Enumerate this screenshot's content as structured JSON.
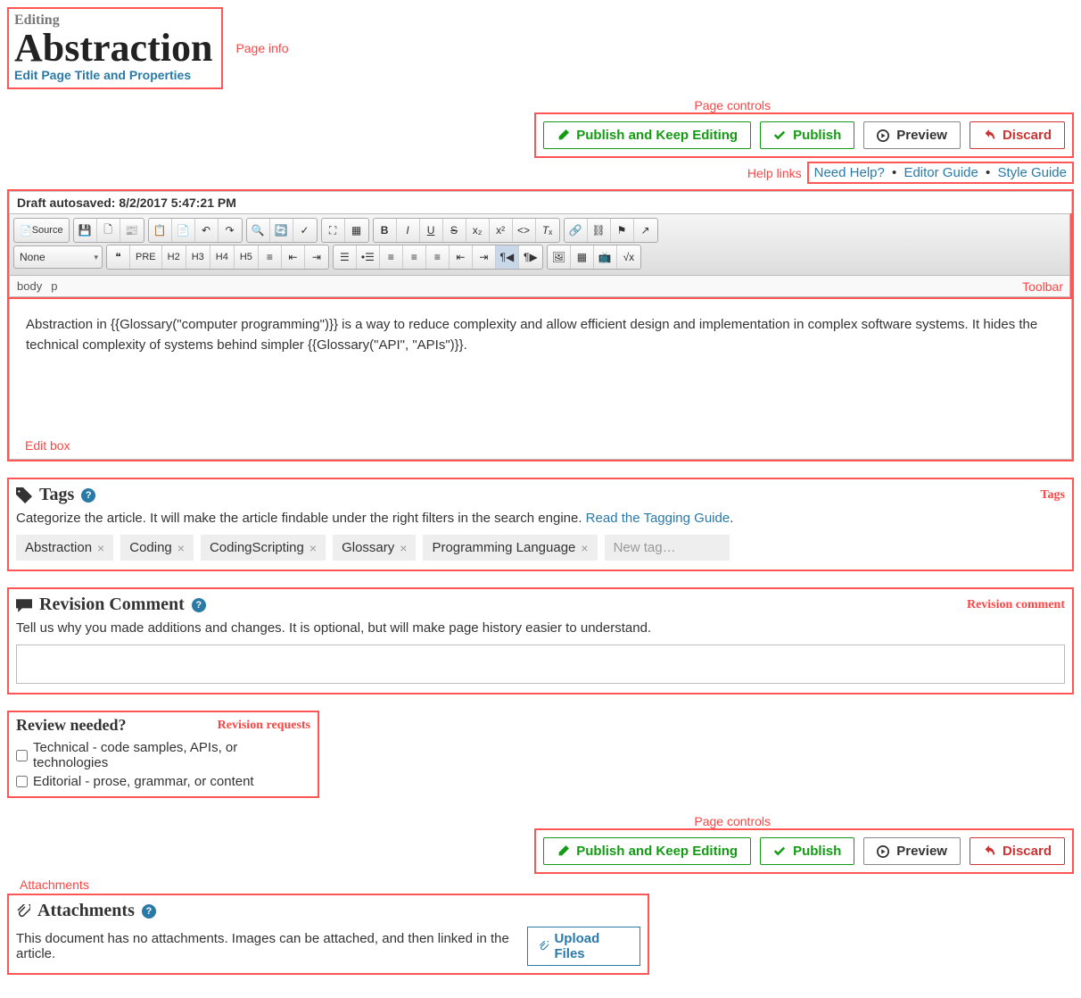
{
  "page_info": {
    "editing_label": "Editing",
    "title": "Abstraction",
    "edit_props_link": "Edit Page Title and Properties",
    "annotation": "Page info"
  },
  "page_controls": {
    "annotation": "Page controls",
    "publish_keep": "Publish and Keep Editing",
    "publish": "Publish",
    "preview": "Preview",
    "discard": "Discard"
  },
  "help_links": {
    "annotation": "Help links",
    "need_help": "Need Help?",
    "editor_guide": "Editor Guide",
    "style_guide": "Style Guide"
  },
  "editor": {
    "autosave": "Draft autosaved: 8/2/2017 5:47:21 PM",
    "toolbar_annotation": "Toolbar",
    "editbox_annotation": "Edit box",
    "source_label": "Source",
    "format_select": "None",
    "path": [
      "body",
      "p"
    ],
    "h2": "H2",
    "h3": "H3",
    "h4": "H4",
    "h5": "H5",
    "pre": "PRE",
    "content": "Abstraction in {{Glossary(\"computer programming\")}} is a way to reduce complexity and allow efficient design and implementation in complex software systems. It hides the technical complexity of systems behind simpler {{Glossary(\"API\", \"APIs\")}}."
  },
  "tags": {
    "annotation": "Tags",
    "heading": "Tags",
    "desc": "Categorize the article. It will make the article findable under the right filters in the search engine. ",
    "guide_link": "Read the Tagging Guide",
    "period": ".",
    "items": [
      "Abstraction",
      "Coding",
      "CodingScripting",
      "Glossary",
      "Programming Language"
    ],
    "new_placeholder": "New tag…"
  },
  "revision": {
    "annotation": "Revision comment",
    "heading": "Revision Comment",
    "desc": "Tell us why you made additions and changes. It is optional, but will make page history easier to understand."
  },
  "review": {
    "annotation": "Revision requests",
    "heading": "Review needed?",
    "technical": "Technical - code samples, APIs, or technologies",
    "editorial": "Editorial - prose, grammar, or content"
  },
  "attachments": {
    "annotation": "Attachments",
    "heading": "Attachments",
    "desc": "This document has no attachments. Images can be attached, and then linked in the article.",
    "upload": "Upload Files"
  }
}
